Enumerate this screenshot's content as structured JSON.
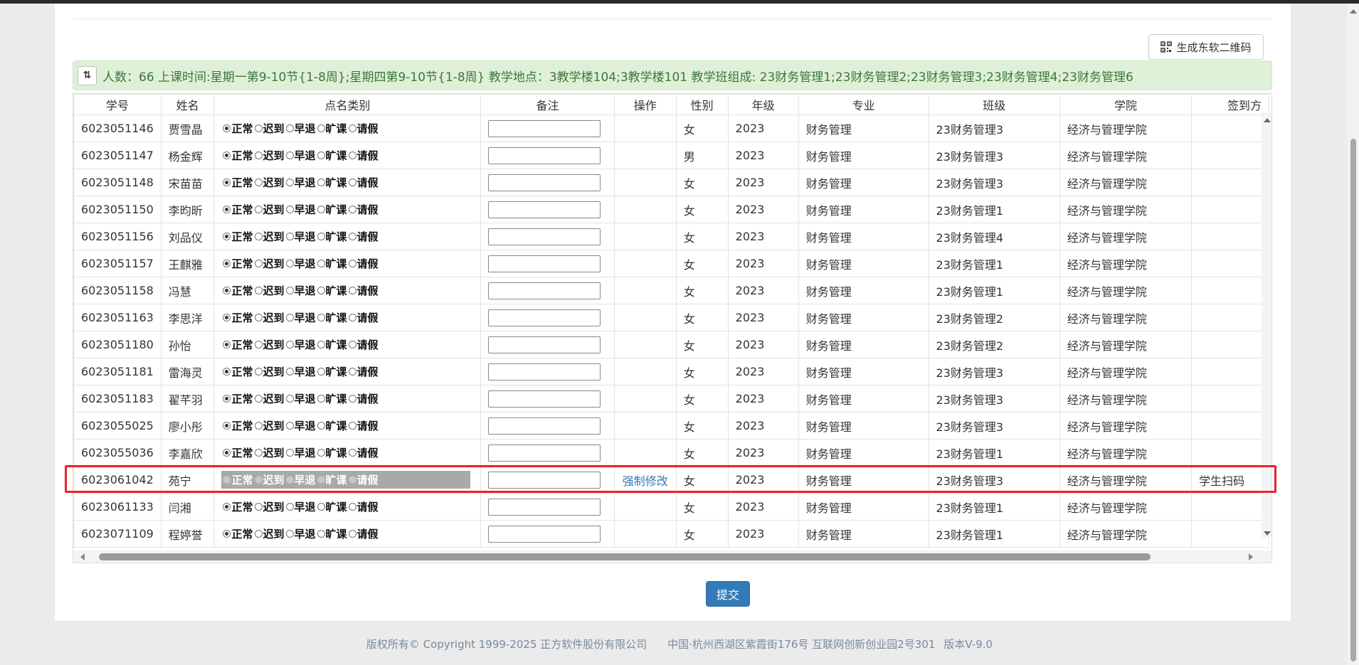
{
  "toolbar": {
    "qr_label": "生成东软二维码"
  },
  "info_bar": {
    "text": "人数：66 上课时间:星期一第9-10节{1-8周};星期四第9-10节{1-8周} 教学地点：3教学楼104;3教学楼101 教学班组成: 23财务管理1;23财务管理2;23财务管理3;23财务管理4;23财务管理6"
  },
  "table": {
    "headers": [
      "学号",
      "姓名",
      "点名类别",
      "备注",
      "操作",
      "性别",
      "年级",
      "专业",
      "班级",
      "学院",
      "签到方"
    ],
    "radio_options": [
      "正常",
      "迟到",
      "早退",
      "旷课",
      "请假"
    ],
    "rows": [
      {
        "id": "6023051146",
        "name": "贾雪晶",
        "action": "",
        "gender": "女",
        "grade": "2023",
        "major": "财务管理",
        "class": "23财务管理3",
        "college": "经济与管理学院",
        "signin": ""
      },
      {
        "id": "6023051147",
        "name": "杨金辉",
        "action": "",
        "gender": "男",
        "grade": "2023",
        "major": "财务管理",
        "class": "23财务管理3",
        "college": "经济与管理学院",
        "signin": ""
      },
      {
        "id": "6023051148",
        "name": "宋苗苗",
        "action": "",
        "gender": "女",
        "grade": "2023",
        "major": "财务管理",
        "class": "23财务管理3",
        "college": "经济与管理学院",
        "signin": ""
      },
      {
        "id": "6023051150",
        "name": "李昀昕",
        "action": "",
        "gender": "女",
        "grade": "2023",
        "major": "财务管理",
        "class": "23财务管理1",
        "college": "经济与管理学院",
        "signin": ""
      },
      {
        "id": "6023051156",
        "name": "刘品仪",
        "action": "",
        "gender": "女",
        "grade": "2023",
        "major": "财务管理",
        "class": "23财务管理4",
        "college": "经济与管理学院",
        "signin": ""
      },
      {
        "id": "6023051157",
        "name": "王麒雅",
        "action": "",
        "gender": "女",
        "grade": "2023",
        "major": "财务管理",
        "class": "23财务管理1",
        "college": "经济与管理学院",
        "signin": ""
      },
      {
        "id": "6023051158",
        "name": "冯慧",
        "action": "",
        "gender": "女",
        "grade": "2023",
        "major": "财务管理",
        "class": "23财务管理1",
        "college": "经济与管理学院",
        "signin": ""
      },
      {
        "id": "6023051163",
        "name": "李思洋",
        "action": "",
        "gender": "女",
        "grade": "2023",
        "major": "财务管理",
        "class": "23财务管理2",
        "college": "经济与管理学院",
        "signin": ""
      },
      {
        "id": "6023051180",
        "name": "孙怡",
        "action": "",
        "gender": "女",
        "grade": "2023",
        "major": "财务管理",
        "class": "23财务管理2",
        "college": "经济与管理学院",
        "signin": ""
      },
      {
        "id": "6023051181",
        "name": "雷海灵",
        "action": "",
        "gender": "女",
        "grade": "2023",
        "major": "财务管理",
        "class": "23财务管理3",
        "college": "经济与管理学院",
        "signin": ""
      },
      {
        "id": "6023051183",
        "name": "翟芊羽",
        "action": "",
        "gender": "女",
        "grade": "2023",
        "major": "财务管理",
        "class": "23财务管理3",
        "college": "经济与管理学院",
        "signin": ""
      },
      {
        "id": "6023055025",
        "name": "廖小彤",
        "action": "",
        "gender": "女",
        "grade": "2023",
        "major": "财务管理",
        "class": "23财务管理3",
        "college": "经济与管理学院",
        "signin": ""
      },
      {
        "id": "6023055036",
        "name": "李嘉欣",
        "action": "",
        "gender": "女",
        "grade": "2023",
        "major": "财务管理",
        "class": "23财务管理1",
        "college": "经济与管理学院",
        "signin": ""
      },
      {
        "id": "6023061042",
        "name": "苑宁",
        "action": "强制修改",
        "gender": "女",
        "grade": "2023",
        "major": "财务管理",
        "class": "23财务管理3",
        "college": "经济与管理学院",
        "signin": "学生扫码",
        "disabled": true
      },
      {
        "id": "6023061133",
        "name": "闫湘",
        "action": "",
        "gender": "女",
        "grade": "2023",
        "major": "财务管理",
        "class": "23财务管理1",
        "college": "经济与管理学院",
        "signin": ""
      },
      {
        "id": "6023071109",
        "name": "程婷誉",
        "action": "",
        "gender": "女",
        "grade": "2023",
        "major": "财务管理",
        "class": "23财务管理1",
        "college": "经济与管理学院",
        "signin": ""
      }
    ]
  },
  "submit_label": "提交",
  "footer": {
    "copyright": "版权所有© Copyright 1999-2025 正方软件股份有限公司",
    "address": "中国·杭州西湖区紫霞街176号 互联网创新创业园2号301",
    "version": "版本V-9.0"
  },
  "colors": {
    "accent": "#337ab7",
    "info_bg": "#dff0d8",
    "info_text": "#3c763d",
    "highlight": "#e8232c"
  }
}
